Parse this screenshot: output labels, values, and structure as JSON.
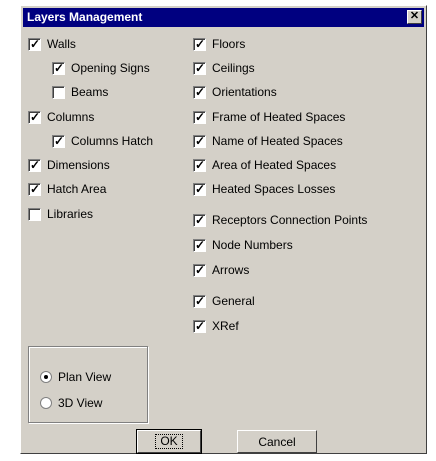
{
  "dialog": {
    "title": "Layers Management",
    "close_glyph": "✕"
  },
  "left_items": [
    {
      "label": "Walls",
      "checked": true
    },
    {
      "label": "Opening Signs",
      "checked": true
    },
    {
      "label": "Beams",
      "checked": false
    },
    {
      "label": "Columns",
      "checked": true
    },
    {
      "label": "Columns Hatch",
      "checked": true
    },
    {
      "label": "Dimensions",
      "checked": true
    },
    {
      "label": "Hatch Area",
      "checked": true
    },
    {
      "label": "Libraries",
      "checked": false
    }
  ],
  "right_items": [
    {
      "label": "Floors",
      "checked": true
    },
    {
      "label": "Ceilings",
      "checked": true
    },
    {
      "label": "Orientations",
      "checked": true
    },
    {
      "label": "Frame of Heated Spaces",
      "checked": true
    },
    {
      "label": "Name of Heated Spaces",
      "checked": true
    },
    {
      "label": "Area of Heated Spaces",
      "checked": true
    },
    {
      "label": "Heated Spaces Losses",
      "checked": true
    },
    {
      "label": "Receptors Connection Points",
      "checked": true
    },
    {
      "label": "Node Numbers",
      "checked": true
    },
    {
      "label": "Arrows",
      "checked": true
    },
    {
      "label": "General",
      "checked": true
    },
    {
      "label": "XRef",
      "checked": true
    }
  ],
  "view_options": [
    {
      "label": "Plan View",
      "selected": true
    },
    {
      "label": "3D View",
      "selected": false
    }
  ],
  "buttons": {
    "ok": "OK",
    "cancel": "Cancel"
  },
  "check_glyph": "✓"
}
